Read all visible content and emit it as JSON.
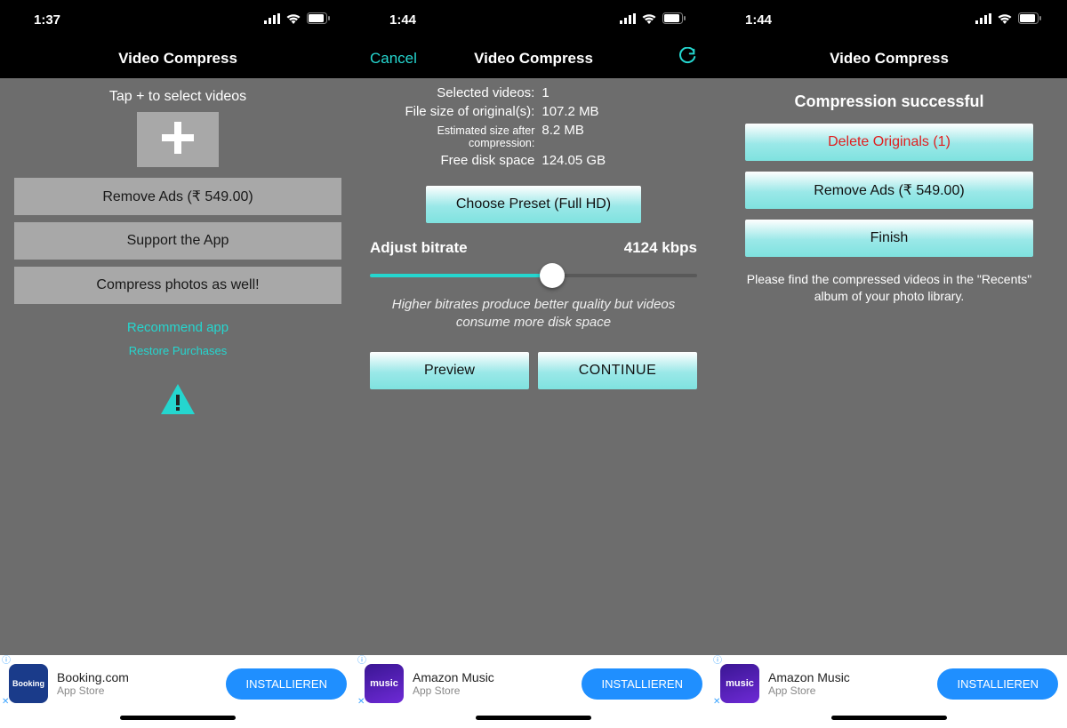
{
  "colors": {
    "accent": "#25d6cf",
    "danger": "#e02020",
    "adInstall": "#1f8fff"
  },
  "screen1": {
    "statusTime": "1:37",
    "navTitle": "Video Compress",
    "hint": "Tap + to select videos",
    "removeAds": "Remove Ads (₹ 549.00)",
    "support": "Support the App",
    "compressPhotos": "Compress photos as well!",
    "recommend": "Recommend app",
    "restore": "Restore Purchases",
    "ad": {
      "iconLabel": "Booking",
      "title": "Booking.com",
      "subtitle": "App Store",
      "install": "INSTALLIEREN"
    }
  },
  "screen2": {
    "statusTime": "1:44",
    "navCancel": "Cancel",
    "navTitle": "Video Compress",
    "rows": {
      "selVideosLabel": "Selected videos:",
      "selVideosValue": "1",
      "origSizeLabel": "File size of original(s):",
      "origSizeValue": "107.2 MB",
      "estSizeLabel": "Estimated size after compression:",
      "estSizeValue": "8.2 MB",
      "freeSpaceLabel": "Free disk space",
      "freeSpaceValue": "124.05 GB"
    },
    "preset": "Choose Preset (Full HD)",
    "bitrateLabel": "Adjust bitrate",
    "bitrateValue": "4124 kbps",
    "sliderHint": "Higher bitrates produce better quality but videos consume more disk space",
    "preview": "Preview",
    "continue": "CONTINUE",
    "ad": {
      "iconLabel": "music",
      "title": "Amazon Music",
      "subtitle": "App Store",
      "install": "INSTALLIEREN"
    }
  },
  "screen3": {
    "statusTime": "1:44",
    "navTitle": "Video Compress",
    "successTitle": "Compression successful",
    "deleteOriginals": "Delete Originals (1)",
    "removeAds": "Remove Ads (₹ 549.00)",
    "finish": "Finish",
    "message": "Please find the compressed videos in the \"Recents\" album of your photo library.",
    "ad": {
      "iconLabel": "music",
      "title": "Amazon Music",
      "subtitle": "App Store",
      "install": "INSTALLIEREN"
    }
  }
}
